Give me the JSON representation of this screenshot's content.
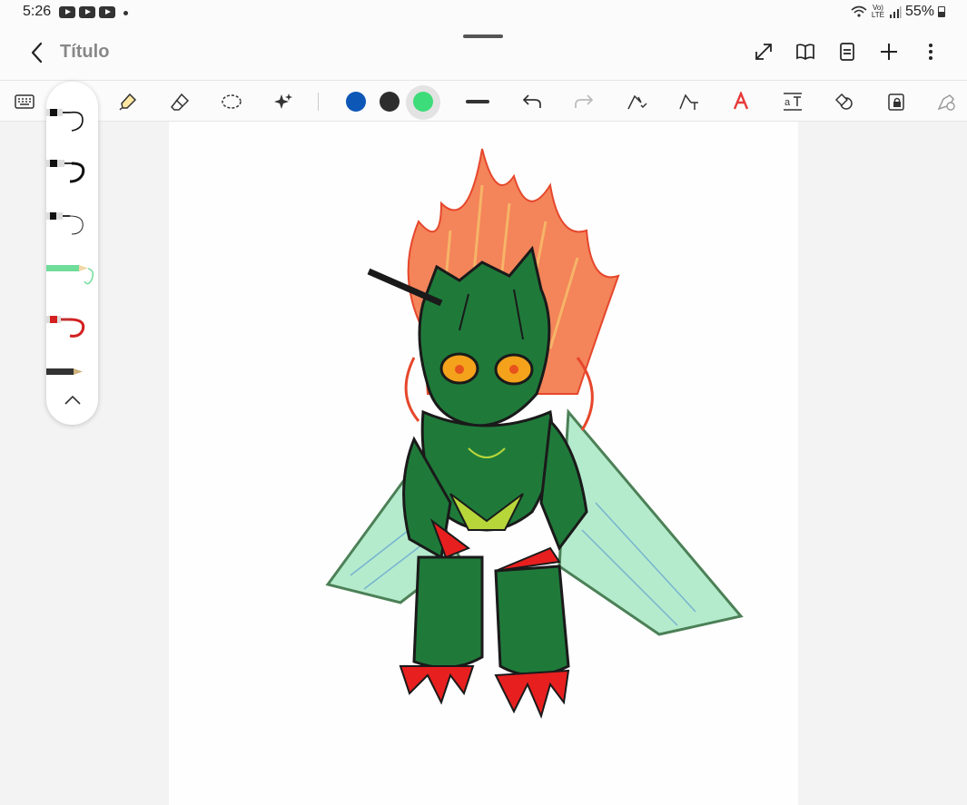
{
  "status_bar": {
    "time": "5:26",
    "notification_icons": [
      "youtube-icon",
      "youtube-icon",
      "youtube-icon"
    ],
    "network_label": "Vo) LTE",
    "battery": "55%"
  },
  "header": {
    "title": "Título",
    "icons": [
      "back-arrow-icon",
      "expand-icon",
      "book-view-icon",
      "page-icon",
      "plus-icon",
      "more-vert-icon"
    ]
  },
  "toolbar": {
    "tools": [
      "keyboard-icon",
      "pen-icon",
      "highlighter-icon",
      "eraser-icon",
      "lasso-icon",
      "ai-sparkle-icon",
      "stroke-width-icon",
      "undo-icon",
      "redo-icon",
      "shape-assist-icon",
      "text-shape-icon",
      "text-color-icon",
      "text-box-icon",
      "shapes-icon",
      "lock-icon",
      "pen-settings-icon"
    ],
    "colors": [
      "#0d57b6",
      "#2d2d2d",
      "#3ddc7a"
    ],
    "selected_color": "#3ddc7a"
  },
  "pen_panel": {
    "pens": [
      {
        "name": "fountain-pen",
        "color": "#111111"
      },
      {
        "name": "brush-pen",
        "color": "#111111"
      },
      {
        "name": "fineliner",
        "color": "#222222"
      },
      {
        "name": "pencil",
        "color": "#6fdc9a"
      },
      {
        "name": "marker",
        "color": "#d32020"
      },
      {
        "name": "pencil-2",
        "color": "#cdb27a"
      }
    ]
  },
  "drawing": {
    "description_colors": {
      "flame": "#f26b3a",
      "body": "#1f7a3a",
      "wing": "#8fe0b5",
      "eye": "#f4a21c",
      "claw": "#e81f1f"
    }
  }
}
